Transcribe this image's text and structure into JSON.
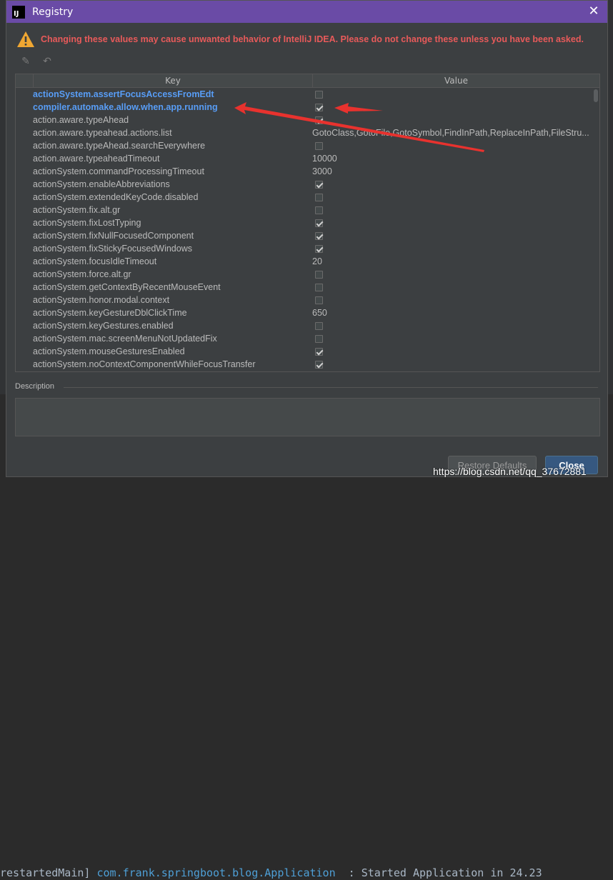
{
  "window": {
    "title": "Registry",
    "app_icon_text": "IJ"
  },
  "warning": "Changing these values may cause unwanted behavior of IntelliJ IDEA. Please do not change these unless you have been asked.",
  "table": {
    "headers": {
      "key": "Key",
      "value": "Value"
    },
    "rows": [
      {
        "key": "actionSystem.assertFocusAccessFromEdt",
        "type": "bool",
        "checked": false,
        "modified": true
      },
      {
        "key": "compiler.automake.allow.when.app.running",
        "type": "bool",
        "checked": true,
        "modified": true
      },
      {
        "key": "action.aware.typeAhead",
        "type": "bool",
        "checked": true,
        "modified": false
      },
      {
        "key": "action.aware.typeahead.actions.list",
        "type": "text",
        "value": "GotoClass,GotoFile,GotoSymbol,FindInPath,ReplaceInPath,FileStru...",
        "modified": false
      },
      {
        "key": "action.aware.typeAhead.searchEverywhere",
        "type": "bool",
        "checked": false,
        "modified": false
      },
      {
        "key": "action.aware.typeaheadTimeout",
        "type": "text",
        "value": "10000",
        "modified": false
      },
      {
        "key": "actionSystem.commandProcessingTimeout",
        "type": "text",
        "value": "3000",
        "modified": false
      },
      {
        "key": "actionSystem.enableAbbreviations",
        "type": "bool",
        "checked": true,
        "modified": false
      },
      {
        "key": "actionSystem.extendedKeyCode.disabled",
        "type": "bool",
        "checked": false,
        "modified": false
      },
      {
        "key": "actionSystem.fix.alt.gr",
        "type": "bool",
        "checked": false,
        "modified": false
      },
      {
        "key": "actionSystem.fixLostTyping",
        "type": "bool",
        "checked": true,
        "modified": false
      },
      {
        "key": "actionSystem.fixNullFocusedComponent",
        "type": "bool",
        "checked": true,
        "modified": false
      },
      {
        "key": "actionSystem.fixStickyFocusedWindows",
        "type": "bool",
        "checked": true,
        "modified": false
      },
      {
        "key": "actionSystem.focusIdleTimeout",
        "type": "text",
        "value": "20",
        "modified": false
      },
      {
        "key": "actionSystem.force.alt.gr",
        "type": "bool",
        "checked": false,
        "modified": false
      },
      {
        "key": "actionSystem.getContextByRecentMouseEvent",
        "type": "bool",
        "checked": false,
        "modified": false
      },
      {
        "key": "actionSystem.honor.modal.context",
        "type": "bool",
        "checked": false,
        "modified": false
      },
      {
        "key": "actionSystem.keyGestureDblClickTime",
        "type": "text",
        "value": "650",
        "modified": false
      },
      {
        "key": "actionSystem.keyGestures.enabled",
        "type": "bool",
        "checked": false,
        "modified": false
      },
      {
        "key": "actionSystem.mac.screenMenuNotUpdatedFix",
        "type": "bool",
        "checked": false,
        "modified": false
      },
      {
        "key": "actionSystem.mouseGesturesEnabled",
        "type": "bool",
        "checked": true,
        "modified": false
      },
      {
        "key": "actionSystem.noContextComponentWhileFocusTransfer",
        "type": "bool",
        "checked": true,
        "modified": false
      }
    ]
  },
  "description": {
    "label": "Description"
  },
  "buttons": {
    "restore": "Restore Defaults",
    "close": "Close"
  },
  "background": {
    "console_prefix": "restartedMain] ",
    "console_class": "com.frank.springboot.blog.Application",
    "console_suffix": "  : Started Application in 24.23"
  },
  "watermark": "https://blog.csdn.net/qq_37672881",
  "colors": {
    "titlebar": "#6a4ba6",
    "modified_key": "#589df6",
    "warning": "#e85a5a",
    "annotation_arrow": "#e8322e"
  },
  "icons": {
    "edit": "pencil-icon",
    "revert": "undo-icon",
    "warning": "warning-triangle-icon",
    "close": "close-icon"
  }
}
